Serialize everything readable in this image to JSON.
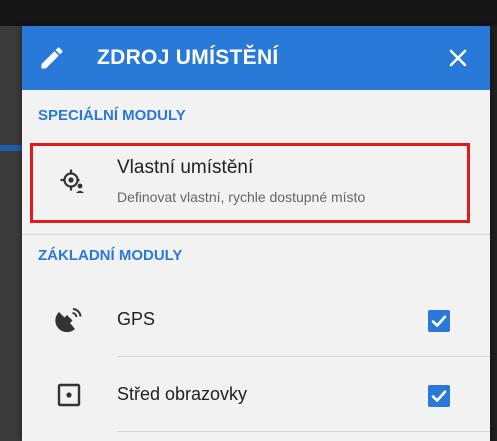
{
  "dialog": {
    "title": "ZDROJ UMÍSTĚNÍ",
    "edit_icon": "pencil-icon",
    "close_icon": "close-icon"
  },
  "sections": {
    "special": {
      "label": "SPECIÁLNÍ MODULY",
      "items": [
        {
          "icon": "custom-location-icon",
          "title": "Vlastní umístění",
          "subtitle": "Definovat vlastní, rychle dostupné místo",
          "highlighted": true
        }
      ]
    },
    "basic": {
      "label": "ZÁKLADNÍ MODULY",
      "items": [
        {
          "icon": "satellite-icon",
          "label": "GPS",
          "checked": true
        },
        {
          "icon": "screen-center-icon",
          "label": "Střed obrazovky",
          "checked": true
        }
      ]
    }
  },
  "colors": {
    "accent": "#2979d9",
    "highlight_border": "#e01b1b",
    "dialog_background": "#f2f2f2"
  }
}
